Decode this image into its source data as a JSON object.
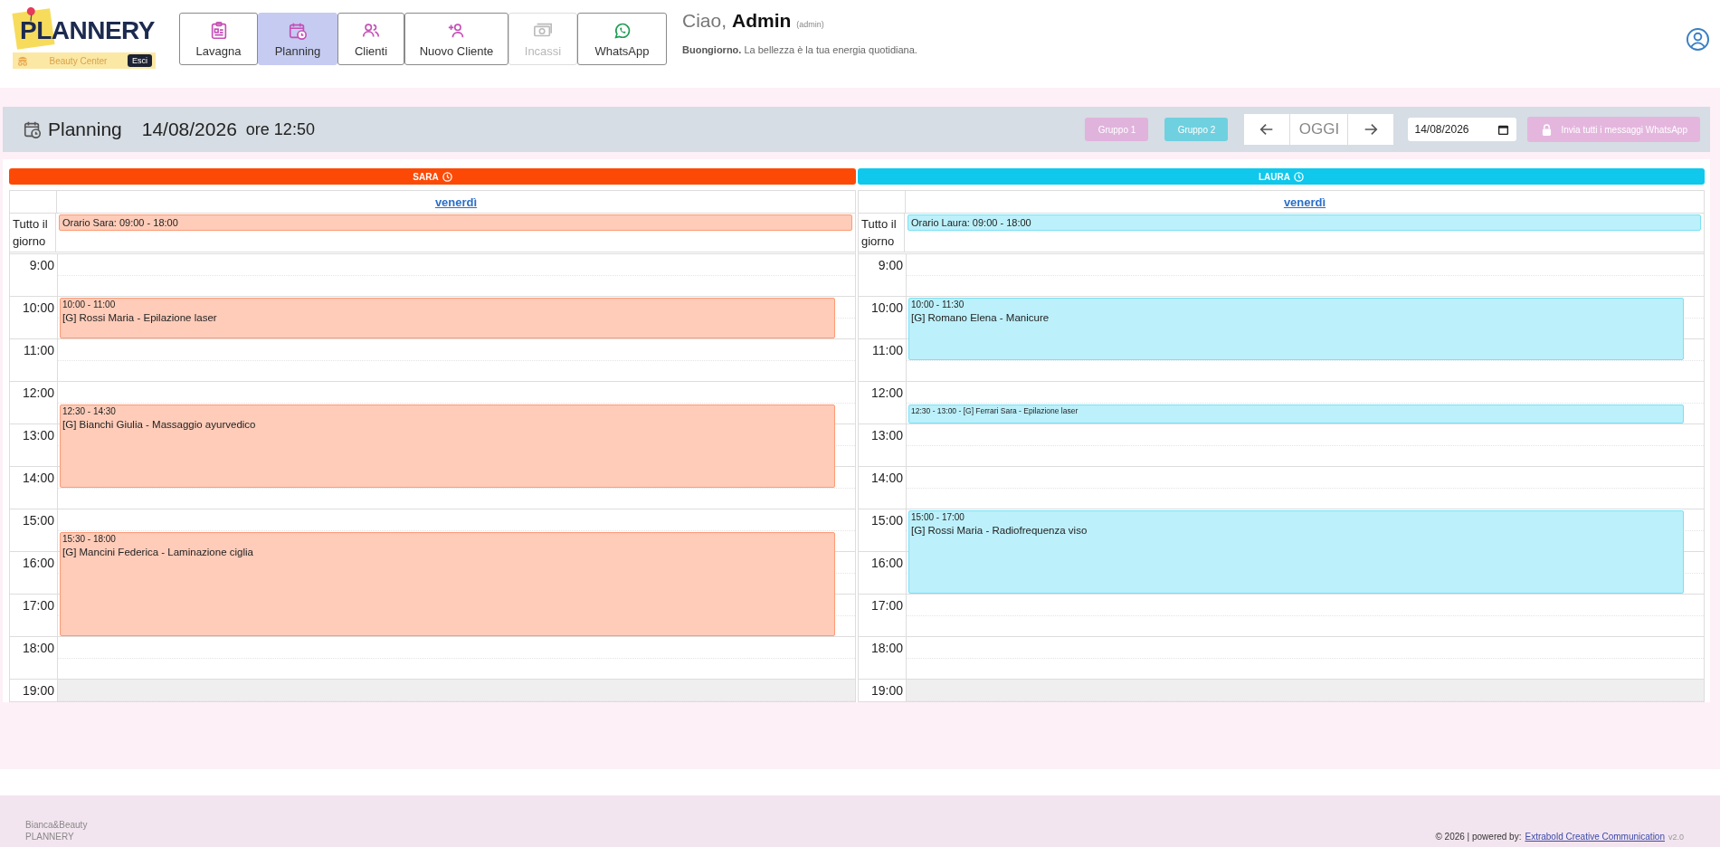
{
  "header": {
    "logo": "PLANNERY",
    "center": "Beauty Center",
    "logout": "Esci",
    "nav": [
      {
        "label": "Lavagna",
        "selected": false,
        "disabled": false
      },
      {
        "label": "Planning",
        "selected": true,
        "disabled": false
      },
      {
        "label": "Clienti",
        "selected": false,
        "disabled": false
      },
      {
        "label": "Nuovo Cliente",
        "selected": false,
        "disabled": false
      },
      {
        "label": "Incassi",
        "selected": false,
        "disabled": true
      },
      {
        "label": "WhatsApp",
        "selected": false,
        "disabled": false
      }
    ],
    "greeting": {
      "hello": "Ciao,",
      "name": "Admin",
      "role": "(admin)",
      "message": "**Buongiorno.** La bellezza è la tua energia quotidiana."
    }
  },
  "toolbar": {
    "title": "Planning",
    "date": "14/08/2026",
    "time": "ore 12:50",
    "groups": [
      {
        "label": "Gruppo 1",
        "color": "#e0b3dc"
      },
      {
        "label": "Gruppo 2",
        "color": "#6fd0df"
      }
    ],
    "today": "OGGI",
    "date_field": "14/08/2026",
    "send": {
      "label": "Invia tutti i messaggi WhatsApp",
      "disabled": true
    }
  },
  "columns": [
    {
      "name": "SARA",
      "color": "#fc4a06",
      "day": "venerdì",
      "all_day_label": "Tutto il giorno",
      "all_day_event": "Orario Sara: 09:00 - 18:00",
      "hours": [
        "9:00",
        "10:00",
        "11:00",
        "12:00",
        "13:00",
        "14:00",
        "15:00",
        "16:00",
        "17:00",
        "18:00",
        "19:00"
      ],
      "events": [
        {
          "kind": "block",
          "time": "10:00 - 11:00",
          "title": "[G] Rossi Maria - Epilazione laser"
        },
        {
          "kind": "block",
          "time": "12:30 - 14:30",
          "title": "[G] Bianchi Giulia - Massaggio ayurvedico"
        },
        {
          "kind": "block",
          "time": "15:30 - 18:00",
          "title": "[G] Mancini Federica - Laminazione ciglia"
        }
      ]
    },
    {
      "name": "LAURA",
      "color": "#0fc8ec",
      "day": "venerdì",
      "all_day_label": "Tutto il giorno",
      "all_day_event": "Orario Laura: 09:00 - 18:00",
      "hours": [
        "9:00",
        "10:00",
        "11:00",
        "12:00",
        "13:00",
        "14:00",
        "15:00",
        "16:00",
        "17:00",
        "18:00",
        "19:00"
      ],
      "events": [
        {
          "kind": "block",
          "time": "10:00 - 11:30",
          "title": "[G] Romano Elena - Manicure"
        },
        {
          "kind": "compact",
          "time": "12:30 - 13:00",
          "title": "- [G] Ferrari Sara - Epilazione laser"
        },
        {
          "kind": "block",
          "time": "15:00 - 17:00",
          "title": "[G] Rossi Maria - Radiofrequenza viso"
        }
      ]
    }
  ],
  "footer": {
    "brand": "Bianca&Beauty",
    "app": "PLANNERY",
    "copyright": "© 2026 | powered by:",
    "link": "Extrabold Creative Communication",
    "version": "v2.0"
  }
}
